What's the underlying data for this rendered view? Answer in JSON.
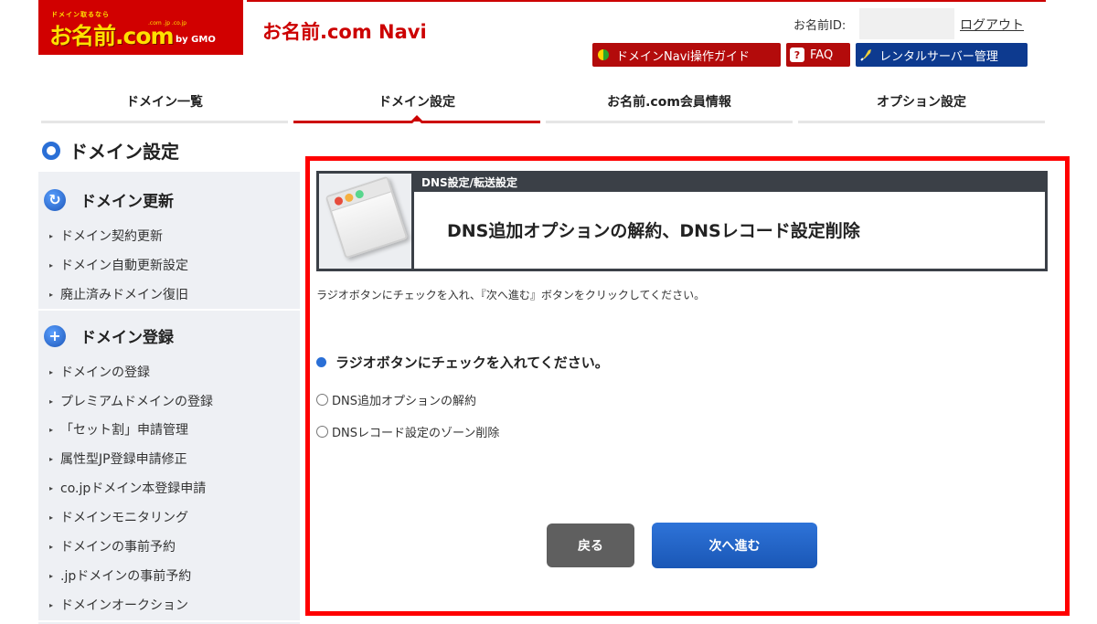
{
  "header": {
    "logo_tagline": "ドメイン取るなら",
    "logo_text": "お名前.com",
    "logo_tlds": ".com .jp .co.jp",
    "logo_gmo": "by GMO",
    "app_title": "お名前.com Navi",
    "member_id_label": "お名前ID:",
    "logout_label": "ログアウト",
    "buttons": {
      "guide": "ドメインNavi操作ガイド",
      "faq": "FAQ",
      "rental": "レンタルサーバー管理"
    }
  },
  "tabs": [
    {
      "label": "ドメイン一覧",
      "active": false
    },
    {
      "label": "ドメイン設定",
      "active": true
    },
    {
      "label": "お名前.com会員情報",
      "active": false
    },
    {
      "label": "オプション設定",
      "active": false
    }
  ],
  "sidebar": {
    "title": "ドメイン設定",
    "sections": [
      {
        "heading": "ドメイン更新",
        "icon": "refresh-icon",
        "items": [
          "ドメイン契約更新",
          "ドメイン自動更新設定",
          "廃止済みドメイン復旧"
        ]
      },
      {
        "heading": "ドメイン登録",
        "icon": "plus-icon",
        "items": [
          "ドメインの登録",
          "プレミアムドメインの登録",
          "「セット割」申請管理",
          "属性型JP登録申請修正",
          "co.jpドメイン本登録申請",
          "ドメインモニタリング",
          "ドメインの事前予約",
          ".jpドメインの事前予約",
          "ドメインオークション"
        ]
      }
    ]
  },
  "main": {
    "panel_label": "DNS設定/転送設定",
    "panel_title": "DNS追加オプションの解約、DNSレコード設定削除",
    "instruction": "ラジオボタンにチェックを入れ、『次へ進む』ボタンをクリックしてください。",
    "prompt": "ラジオボタンにチェックを入れてください。",
    "options": [
      "DNS追加オプションの解約",
      "DNSレコード設定のゾーン削除"
    ],
    "back_label": "戻る",
    "next_label": "次へ進む"
  },
  "colors": {
    "brand_red": "#cc0000",
    "highlight_red": "#ff0000",
    "accent_blue": "#2a6fd6",
    "panel_dark": "#3b4047"
  }
}
